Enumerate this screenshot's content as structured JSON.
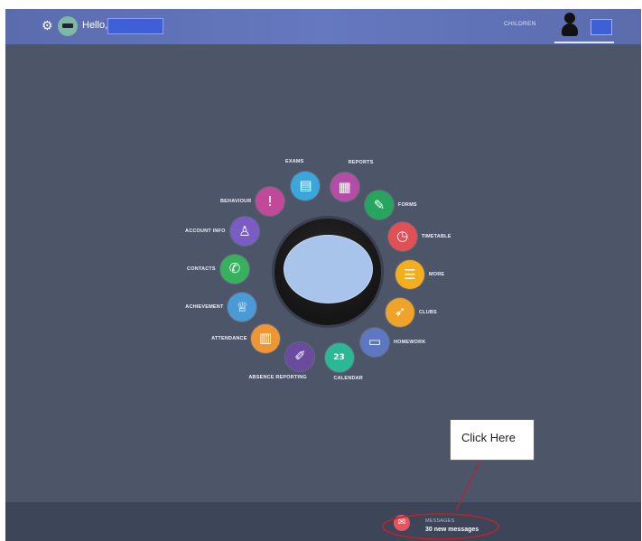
{
  "header": {
    "greeting": "Hello,",
    "children_label": "CHILDREN",
    "gear_icon": "gear-icon",
    "accent": "#5a6fb5"
  },
  "menu": [
    {
      "label": "EXAMS",
      "color": "#3aa7dc",
      "icon": "exams-certificate-icon",
      "glyph": "▤"
    },
    {
      "label": "REPORTS",
      "color": "#b44da6",
      "icon": "reports-document-icon",
      "glyph": "▦"
    },
    {
      "label": "FORMS",
      "color": "#27a45e",
      "icon": "forms-edit-icon",
      "glyph": "✎"
    },
    {
      "label": "TIMETABLE",
      "color": "#e05055",
      "icon": "timetable-clock-icon",
      "glyph": "◷"
    },
    {
      "label": "MORE",
      "color": "#f2ae1c",
      "icon": "more-list-icon",
      "glyph": "☰"
    },
    {
      "label": "CLUBS",
      "color": "#efa429",
      "icon": "clubs-runner-icon",
      "glyph": "➶"
    },
    {
      "label": "HOMEWORK",
      "color": "#5d77c1",
      "icon": "homework-briefcase-icon",
      "glyph": "▭"
    },
    {
      "label": "CALENDAR",
      "color": "#2cb795",
      "icon": "calendar-icon",
      "glyph": "23"
    },
    {
      "label": "ABSENCE REPORTING",
      "color": "#6a4b9e",
      "icon": "absence-flashlight-icon",
      "glyph": "✐"
    },
    {
      "label": "ATTENDANCE",
      "color": "#ee9534",
      "icon": "attendance-chart-icon",
      "glyph": "▥"
    },
    {
      "label": "ACHIEVEMENT",
      "color": "#4a9ad6",
      "icon": "achievement-trophy-icon",
      "glyph": "♕"
    },
    {
      "label": "CONTACTS",
      "color": "#38b15f",
      "icon": "contacts-phone-icon",
      "glyph": "✆"
    },
    {
      "label": "ACCOUNT INFO",
      "color": "#7b5cc6",
      "icon": "account-user-icon",
      "glyph": "♙"
    },
    {
      "label": "BEHAVIOUR",
      "color": "#c04a97",
      "icon": "behaviour-alert-icon",
      "glyph": "!"
    }
  ],
  "messages": {
    "title": "MESSAGES",
    "count_text": "30 new messages",
    "icon": "mail-icon",
    "color": "#e3565f"
  },
  "callout": {
    "text": "Click Here",
    "annotation_color": "#c0202a"
  }
}
